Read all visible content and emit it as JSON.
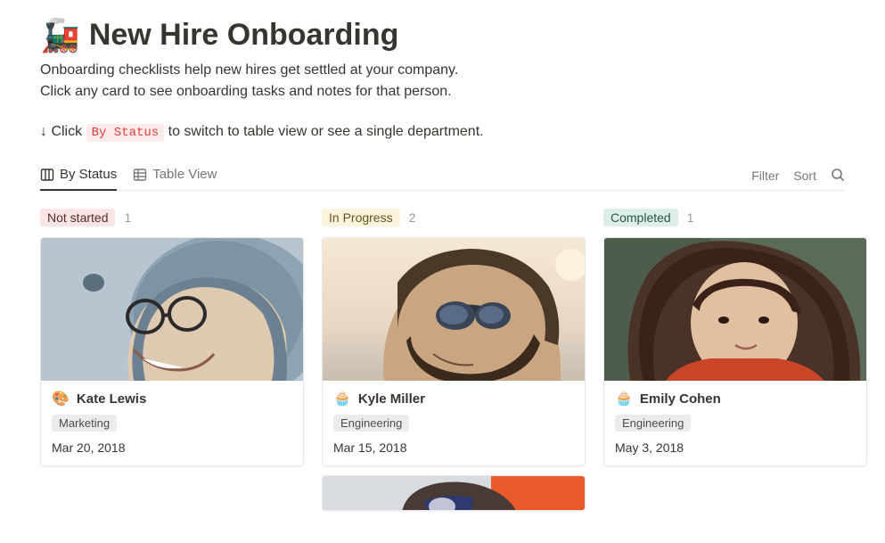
{
  "header": {
    "icon": "🚂",
    "title": "New Hire Onboarding",
    "description_line1": "Onboarding checklists help new hires get settled at your company.",
    "description_line2": "Click any card to see onboarding tasks and notes for that person."
  },
  "hint": {
    "prefix": "↓ Click ",
    "code": "By Status",
    "suffix": " to switch to table view or see a single department."
  },
  "tabs": {
    "by_status": "By Status",
    "table_view": "Table View"
  },
  "controls": {
    "filter": "Filter",
    "sort": "Sort"
  },
  "columns": [
    {
      "status": "Not started",
      "status_class": "status-not-started",
      "count": "1",
      "cards": [
        {
          "emoji": "🎨",
          "name": "Kate Lewis",
          "department": "Marketing",
          "date": "Mar 20, 2018"
        }
      ]
    },
    {
      "status": "In Progress",
      "status_class": "status-in-progress",
      "count": "2",
      "cards": [
        {
          "emoji": "🧁",
          "name": "Kyle Miller",
          "department": "Engineering",
          "date": "Mar 15, 2018"
        }
      ]
    },
    {
      "status": "Completed",
      "status_class": "status-completed",
      "count": "1",
      "cards": [
        {
          "emoji": "🧁",
          "name": "Emily Cohen",
          "department": "Engineering",
          "date": "May 3, 2018"
        }
      ]
    }
  ]
}
